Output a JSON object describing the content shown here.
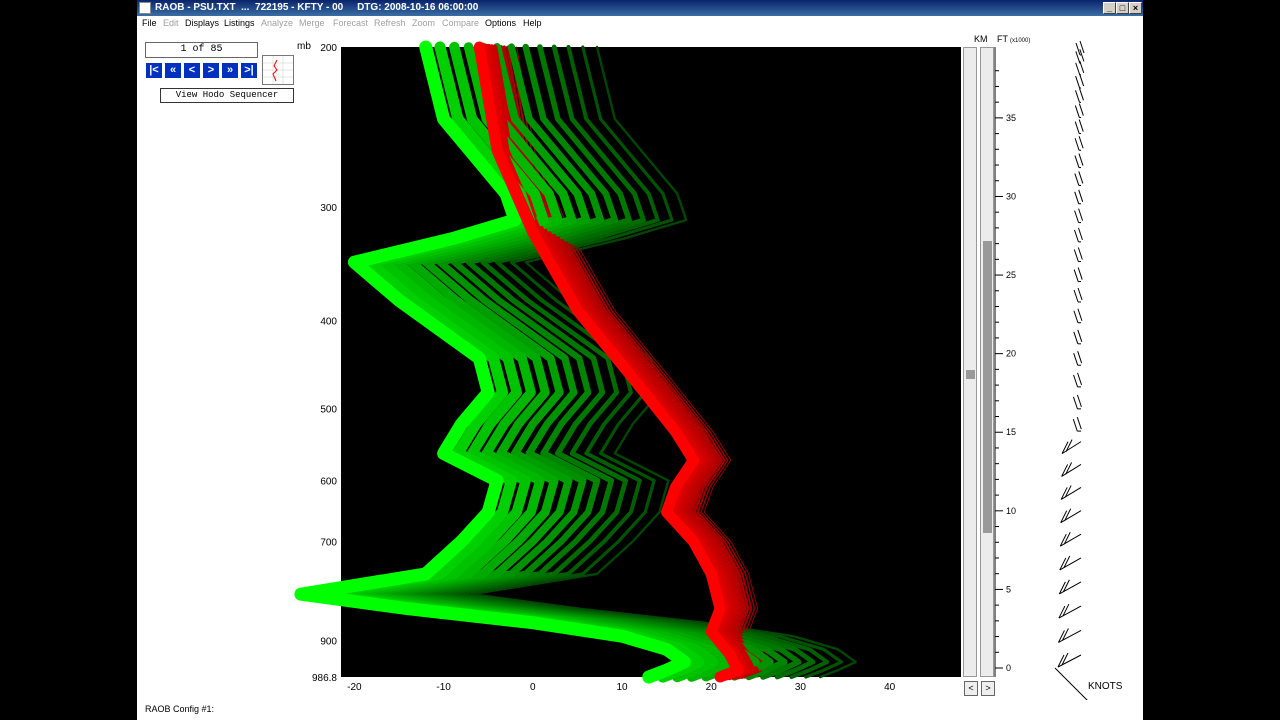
{
  "window": {
    "title": "RAOB - PSU.TXT  ...  722195 - KFTY - 00     DTG: 2008-10-16 06:00:00",
    "controls": [
      "_",
      "□",
      "×"
    ]
  },
  "menu": [
    {
      "label": "File",
      "enabled": true
    },
    {
      "label": "Edit",
      "enabled": false
    },
    {
      "label": "Displays",
      "enabled": true
    },
    {
      "label": "Listings",
      "enabled": true
    },
    {
      "label": "Analyze",
      "enabled": false
    },
    {
      "label": "Merge",
      "enabled": false
    },
    {
      "label": "Forecast",
      "enabled": false
    },
    {
      "label": "Refresh",
      "enabled": false
    },
    {
      "label": "Zoom",
      "enabled": false
    },
    {
      "label": "Compare",
      "enabled": false
    },
    {
      "label": "Options",
      "enabled": true
    },
    {
      "label": "Help",
      "enabled": true
    }
  ],
  "sequencer": {
    "counter": "1 of 85",
    "buttons": [
      "|<",
      "«",
      "<",
      ">",
      "»",
      ">|"
    ],
    "view_hodo": "View Hodo Sequencer"
  },
  "chart_data": {
    "type": "line",
    "pressure_unit": "mb",
    "pressure_labels": [
      200,
      300,
      400,
      500,
      600,
      700,
      900,
      986.8
    ],
    "x_ticks": [
      -20,
      -10,
      0,
      10,
      20,
      30,
      40
    ],
    "xlim": [
      -21.5,
      48
    ],
    "ylim_mb": [
      986.8,
      200
    ],
    "height_labels_km": "KM",
    "height_labels_ft": "FT",
    "height_unit_note": "(x1000)",
    "height_ticks_kft": [
      0,
      5,
      10,
      15,
      20,
      25,
      30,
      35
    ],
    "wind_unit": "KNOTS",
    "series": [
      {
        "role": "temperature",
        "color": "#ff0000",
        "points": [
          [
            -6,
            200
          ],
          [
            -4,
            260
          ],
          [
            0,
            320
          ],
          [
            5,
            390
          ],
          [
            11,
            460
          ],
          [
            16,
            530
          ],
          [
            18,
            570
          ],
          [
            16,
            610
          ],
          [
            15,
            650
          ],
          [
            18,
            700
          ],
          [
            20,
            760
          ],
          [
            21,
            830
          ],
          [
            20,
            880
          ],
          [
            22,
            930
          ],
          [
            23,
            970
          ],
          [
            21,
            986.8
          ]
        ]
      },
      {
        "role": "dewpoint",
        "color": "#00ff00",
        "points": [
          [
            -12,
            200
          ],
          [
            -10,
            240
          ],
          [
            -3,
            290
          ],
          [
            -2,
            310
          ],
          [
            -9,
            325
          ],
          [
            -20,
            345
          ],
          [
            -15,
            380
          ],
          [
            -6,
            440
          ],
          [
            -5,
            480
          ],
          [
            -8,
            520
          ],
          [
            -10,
            560
          ],
          [
            -4,
            600
          ],
          [
            -5,
            650
          ],
          [
            -8,
            700
          ],
          [
            -12,
            760
          ],
          [
            -26,
            800
          ],
          [
            -14,
            830
          ],
          [
            0,
            860
          ],
          [
            10,
            890
          ],
          [
            15,
            920
          ],
          [
            17,
            950
          ],
          [
            15,
            970
          ],
          [
            13,
            986.8
          ]
        ]
      }
    ],
    "ensemble_traces": 12,
    "wind_barbs_count": 32
  },
  "status": {
    "config": "RAOB Config #1:"
  },
  "nav_arrows": [
    "<",
    ">"
  ]
}
